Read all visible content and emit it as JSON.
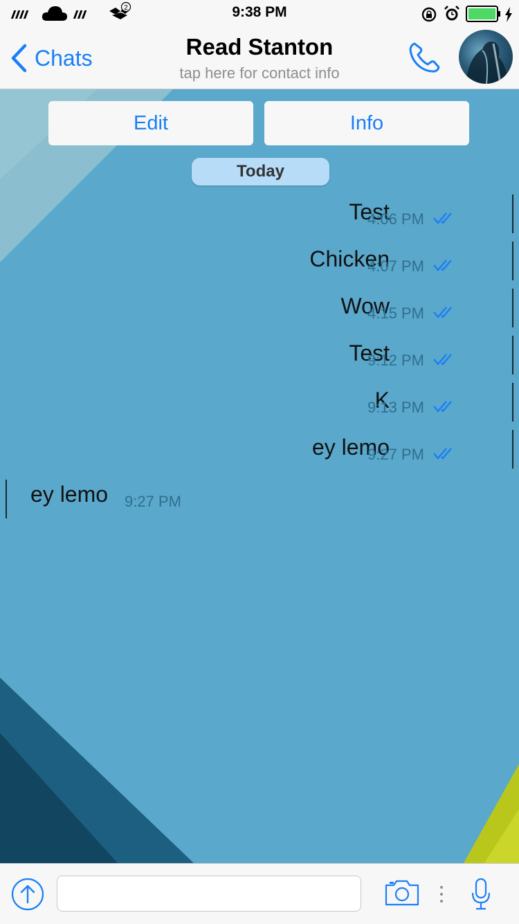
{
  "status_bar": {
    "time": "9:38 PM",
    "notification_count": "2",
    "battery_color": "#4cd964",
    "icons": [
      "signal-bars-icon",
      "cloud-icon",
      "wifi-bars-icon",
      "dropbox-icon",
      "rotation-lock-icon",
      "alarm-icon",
      "battery-icon",
      "charging-bolt-icon"
    ]
  },
  "nav": {
    "back_label": "Chats",
    "title": "Read Stanton",
    "subtitle": "tap here for contact info",
    "accent_color": "#1a7ff6"
  },
  "actions": {
    "edit_label": "Edit",
    "info_label": "Info"
  },
  "date_badge": "Today",
  "messages": [
    {
      "direction": "out",
      "text": "Test",
      "time": "4:06 PM",
      "status": "read"
    },
    {
      "direction": "out",
      "text": "Chicken",
      "time": "4:07 PM",
      "status": "read"
    },
    {
      "direction": "out",
      "text": "Wow",
      "time": "4:15 PM",
      "status": "read"
    },
    {
      "direction": "out",
      "text": "Test",
      "time": "9:12 PM",
      "status": "read"
    },
    {
      "direction": "out",
      "text": "K",
      "time": "9:13 PM",
      "status": "read"
    },
    {
      "direction": "out",
      "text": "ey lemo",
      "time": "9:27 PM",
      "status": "read"
    },
    {
      "direction": "in",
      "text": "ey lemo",
      "time": "9:27 PM"
    }
  ],
  "input": {
    "value": "",
    "placeholder": ""
  }
}
